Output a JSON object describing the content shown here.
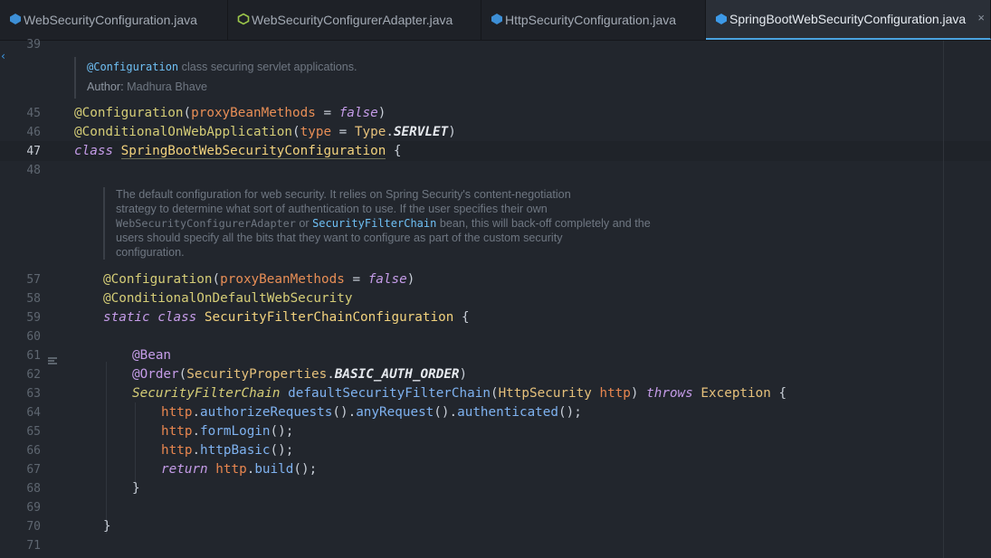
{
  "tabs": [
    {
      "label": "WebSecurityConfiguration.java",
      "icon": "java-class-icon"
    },
    {
      "label": "WebSecurityConfigurerAdapter.java",
      "icon": "abstract-class-icon"
    },
    {
      "label": "HttpSecurityConfiguration.java",
      "icon": "java-class-icon"
    },
    {
      "label": "SpringBootWebSecurityConfiguration.java",
      "icon": "java-class-icon",
      "active": true
    }
  ],
  "close_glyph": "×",
  "line_numbers": [
    "39",
    "45",
    "46",
    "47",
    "48",
    "57",
    "58",
    "59",
    "60",
    "61",
    "62",
    "63",
    "64",
    "65",
    "66",
    "67",
    "68",
    "69",
    "70",
    "71"
  ],
  "current_line": "47",
  "doc1": {
    "tag": "@Configuration",
    "text": " class securing servlet applications.",
    "author_label": "Author:",
    "author": "Madhura Bhave"
  },
  "doc2": {
    "line1": "The default configuration for web security. It relies on Spring Security's content-negotiation",
    "line2": "strategy to determine what sort of authentication to use. If the user specifies their own",
    "line3_a": "WebSecurityConfigurerAdapter",
    "line3_b": " or ",
    "line3_ref": "SecurityFilterChain",
    "line3_c": " bean, this will back-off completely and the",
    "line4": "users should specify all the bits that they want to configure as part of the custom security",
    "line5": "configuration."
  },
  "code": {
    "l45": {
      "ann": "@Configuration",
      "p1": "(",
      "param": "proxyBeanMethods",
      "eq": " = ",
      "val": "false",
      "p2": ")"
    },
    "l46": {
      "ann": "@ConditionalOnWebApplication",
      "p1": "(",
      "param": "type",
      "eq": " = ",
      "type": "Type",
      "dot": ".",
      "const": "SERVLET",
      "p2": ")"
    },
    "l47": {
      "kw": "class",
      "sp": " ",
      "cls": "SpringBootWebSecurityConfiguration",
      "brace": " {"
    },
    "l57": {
      "ann": "@Configuration",
      "p1": "(",
      "param": "proxyBeanMethods",
      "eq": " = ",
      "val": "false",
      "p2": ")"
    },
    "l58": {
      "ann": "@ConditionalOnDefaultWebSecurity"
    },
    "l59": {
      "kw": "static class",
      "sp": " ",
      "cls": "SecurityFilterChainConfiguration",
      "brace": " {"
    },
    "l61": {
      "ann": "@Bean"
    },
    "l62": {
      "ann": "@Order",
      "p1": "(",
      "type": "SecurityProperties",
      "dot": ".",
      "const": "BASIC_AUTH_ORDER",
      "p2": ")"
    },
    "l63": {
      "ret": "SecurityFilterChain",
      "name": "defaultSecurityFilterChain",
      "p1": "(",
      "ptype": "HttpSecurity",
      "pname": "http",
      "p2": ")",
      "throws": "throws",
      "exc": "Exception",
      "brace": " {"
    },
    "l64": {
      "var": "http",
      "d1": ".",
      "m1": "authorizeRequests",
      "c1": "().",
      "m2": "anyRequest",
      "c2": "().",
      "m3": "authenticated",
      "end": "();"
    },
    "l65": {
      "var": "http",
      "d1": ".",
      "m1": "formLogin",
      "end": "();"
    },
    "l66": {
      "var": "http",
      "d1": ".",
      "m1": "httpBasic",
      "end": "();"
    },
    "l67": {
      "kw": "return",
      "var": "http",
      "d1": ".",
      "m1": "build",
      "end": "();"
    },
    "l68": {
      "brace": "}"
    },
    "l70": {
      "brace": "}"
    }
  },
  "colors": {
    "background": "#22262d",
    "tab_active_underline": "#4aa3e0",
    "annotation": "#d5cd77",
    "keyword": "#c59ce8",
    "parameter": "#e88e56",
    "class_name": "#f2d27d",
    "method": "#7fb2f0",
    "doc_text": "#6f7782"
  }
}
